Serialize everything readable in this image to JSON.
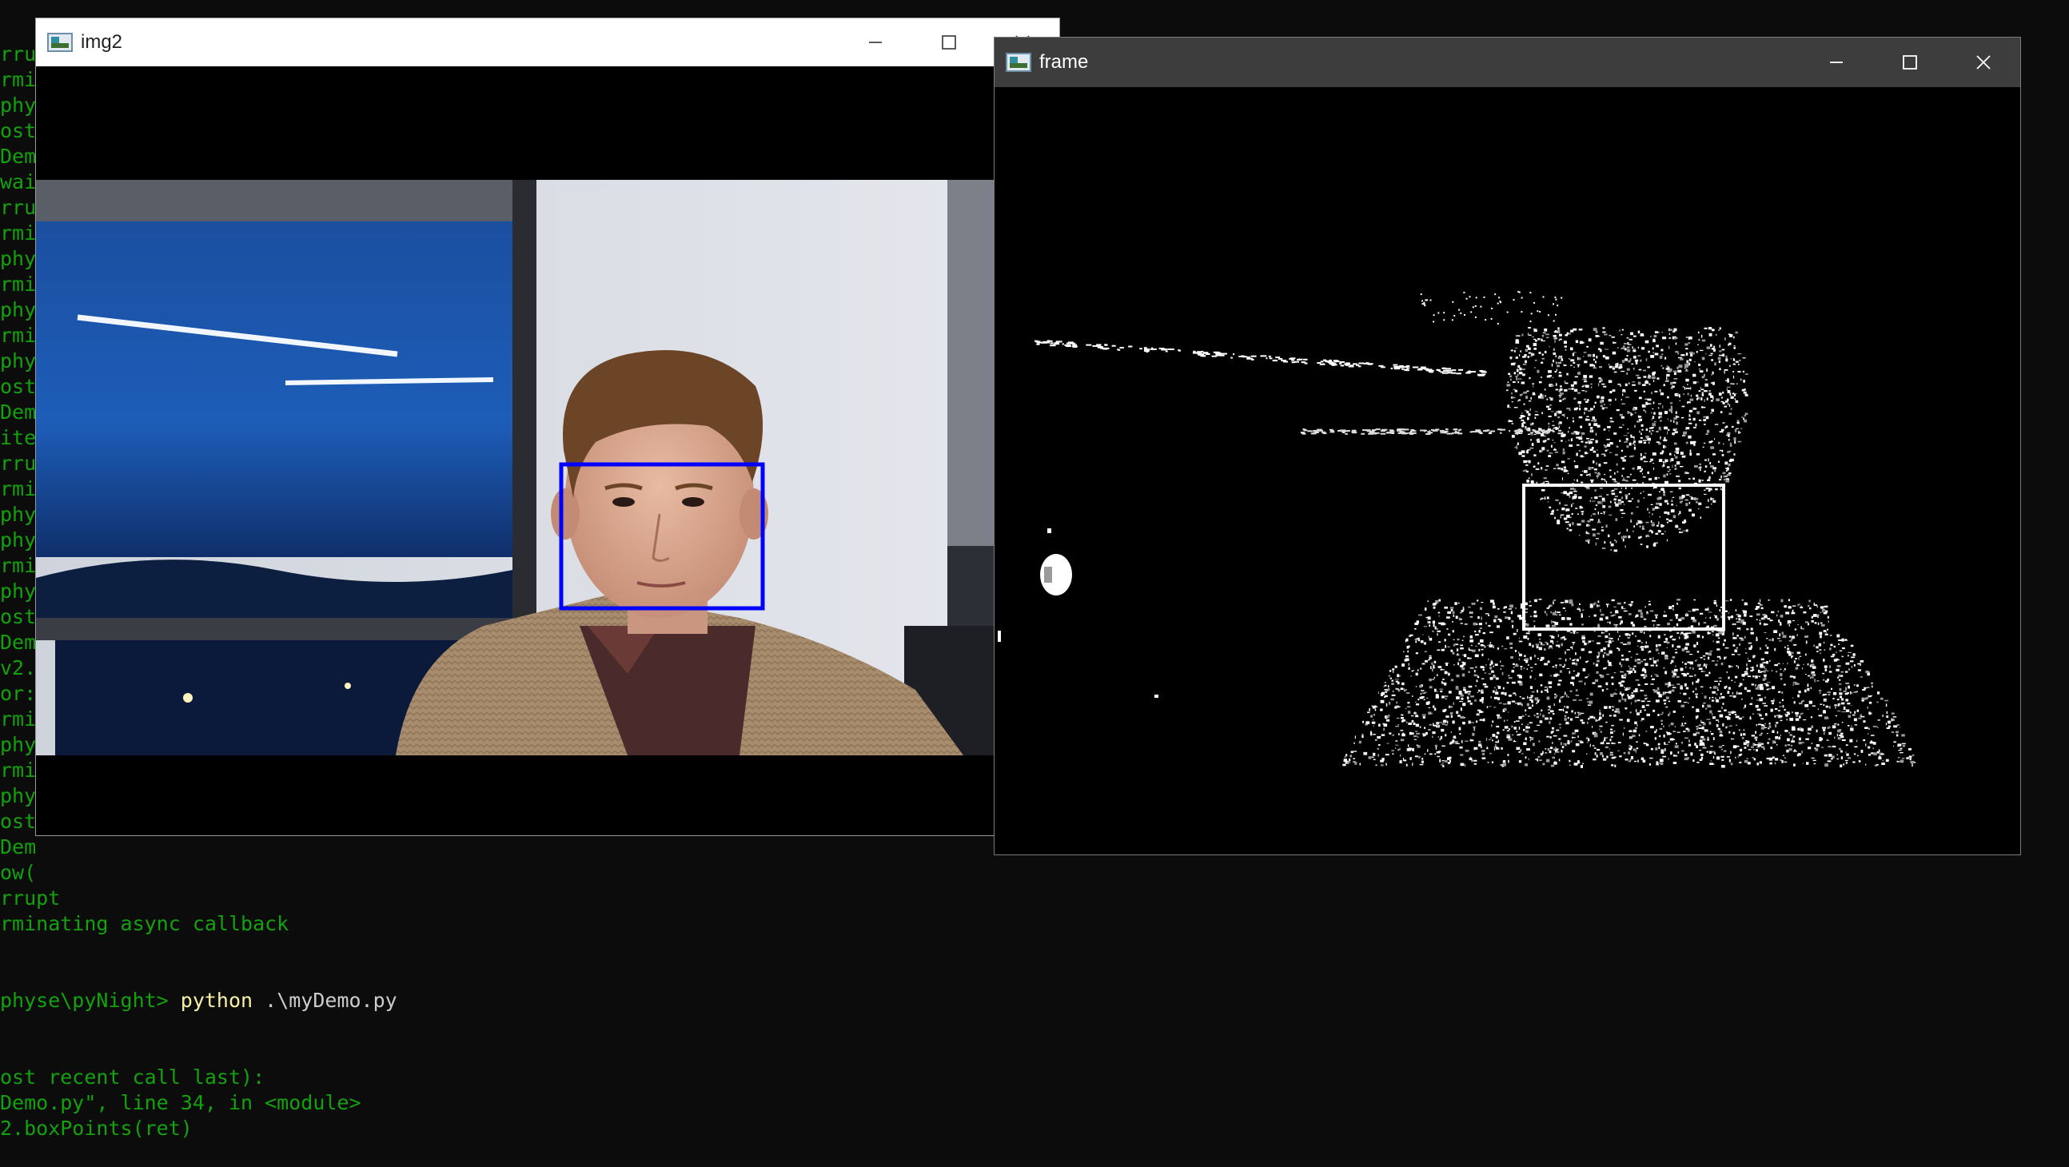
{
  "terminal": {
    "lines": [
      "rrupt",
      "rmi",
      "phy",
      "ost",
      "Dem",
      "wai",
      "rru",
      "rmi",
      "phy",
      "rmi",
      "phy",
      "rmi",
      "phy",
      "ost",
      "Dem",
      "ite",
      "rru",
      "rmi",
      "phy",
      "phy",
      "rmi",
      "phy",
      "ost",
      "Dem",
      "v2.",
      "or:",
      "rmi",
      "phy",
      "rmi",
      "phy",
      "ost",
      "Dem",
      "ow(",
      "rrupt",
      "rminating async callback"
    ],
    "prompt_prefix": "physe\\pyNight> ",
    "prompt_command": "python",
    "prompt_argument": " .\\myDemo.py",
    "after_lines": [
      "ost recent call last):",
      "Demo.py\", line 34, in <module>",
      "2.boxPoints(ret)"
    ]
  },
  "img2_window": {
    "title": "img2",
    "minimize_icon": "minimize-icon",
    "maximize_icon": "maximize-icon",
    "close_icon": "close-icon",
    "detection_box_color": "#0000ff"
  },
  "frame_window": {
    "title": "frame",
    "minimize_icon": "minimize-icon",
    "maximize_icon": "maximize-icon",
    "close_icon": "close-icon",
    "detection_box_color": "#ffffff"
  },
  "colors": {
    "terminal_text": "#13a10e",
    "terminal_command": "#f9f1a5",
    "terminal_bg": "#0c0c0c"
  }
}
